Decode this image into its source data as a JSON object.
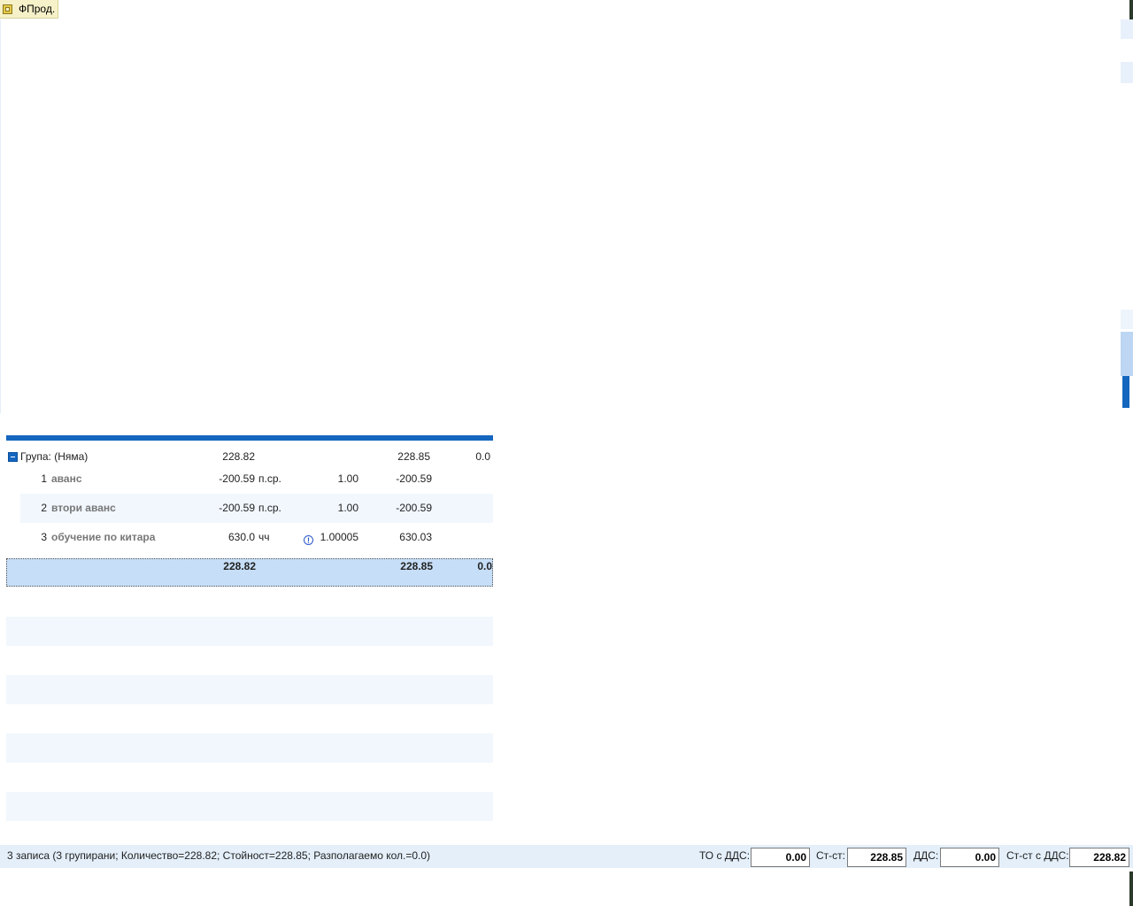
{
  "window": {
    "tab_label": "ФПрод."
  },
  "grid": {
    "group_row": {
      "label": "Група: (Няма)",
      "quantity": "228.82",
      "value": "228.85",
      "available": "0.0"
    },
    "rows": [
      {
        "num": "1",
        "name": "аванс",
        "quantity": "-200.59",
        "unit": "п.ср.",
        "rate": "1.00",
        "value": "-200.59"
      },
      {
        "num": "2",
        "name": "втори аванс",
        "quantity": "-200.59",
        "unit": "п.ср.",
        "rate": "1.00",
        "value": "-200.59"
      },
      {
        "num": "3",
        "name": "обучение по китара",
        "quantity": "630.0",
        "unit": "чч",
        "rate": "1.00005",
        "value": "630.03",
        "warning_icon": "info-icon"
      }
    ],
    "total_row": {
      "quantity": "228.82",
      "value": "228.85",
      "available": "0.0"
    }
  },
  "status": {
    "summary": "3 записа (3 групирани; Количество=228.82; Стойност=228.85; Разполагаемо кол.=0.0)",
    "fields": [
      {
        "label": "ТО с ДДС:",
        "value": "0.00"
      },
      {
        "label": "Ст-ст:",
        "value": "228.85"
      },
      {
        "label": "ДДС:",
        "value": "0.00"
      },
      {
        "label": "Ст-ст с ДДС:",
        "value": "228.82"
      }
    ]
  },
  "colors": {
    "accent": "#1466bf",
    "row_alt": "#f1f7fd",
    "selection": "#c6def7",
    "status_bg": "#e4effa"
  }
}
